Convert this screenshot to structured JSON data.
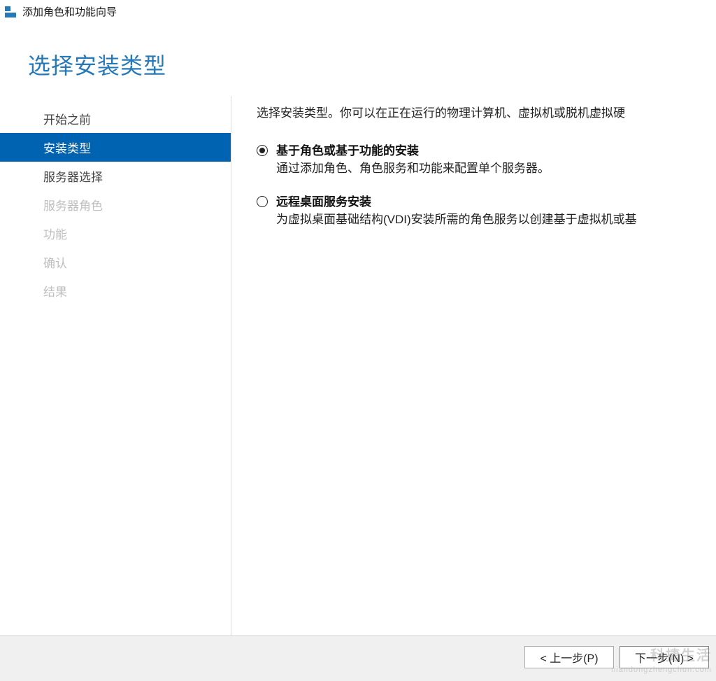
{
  "window": {
    "title": "添加角色和功能向导"
  },
  "header": {
    "page_title": "选择安装类型"
  },
  "sidebar": {
    "steps": [
      {
        "label": "开始之前",
        "state": "normal"
      },
      {
        "label": "安装类型",
        "state": "active"
      },
      {
        "label": "服务器选择",
        "state": "normal"
      },
      {
        "label": "服务器角色",
        "state": "disabled"
      },
      {
        "label": "功能",
        "state": "disabled"
      },
      {
        "label": "确认",
        "state": "disabled"
      },
      {
        "label": "结果",
        "state": "disabled"
      }
    ]
  },
  "content": {
    "instruction": "选择安装类型。你可以在正在运行的物理计算机、虚拟机或脱机虚拟硬",
    "options": [
      {
        "id": "role-based",
        "title": "基于角色或基于功能的安装",
        "desc": "通过添加角色、角色服务和功能来配置单个服务器。",
        "selected": true
      },
      {
        "id": "rds",
        "title": "远程桌面服务安装",
        "desc": "为虚拟桌面基础结构(VDI)安装所需的角色服务以创建基于虚拟机或基",
        "selected": false
      }
    ]
  },
  "footer": {
    "prev": "< 上一步(P)",
    "next": "下一步(N) >"
  },
  "watermark": {
    "main": "科捷生活",
    "sub": "niandongzhengchun.com"
  }
}
